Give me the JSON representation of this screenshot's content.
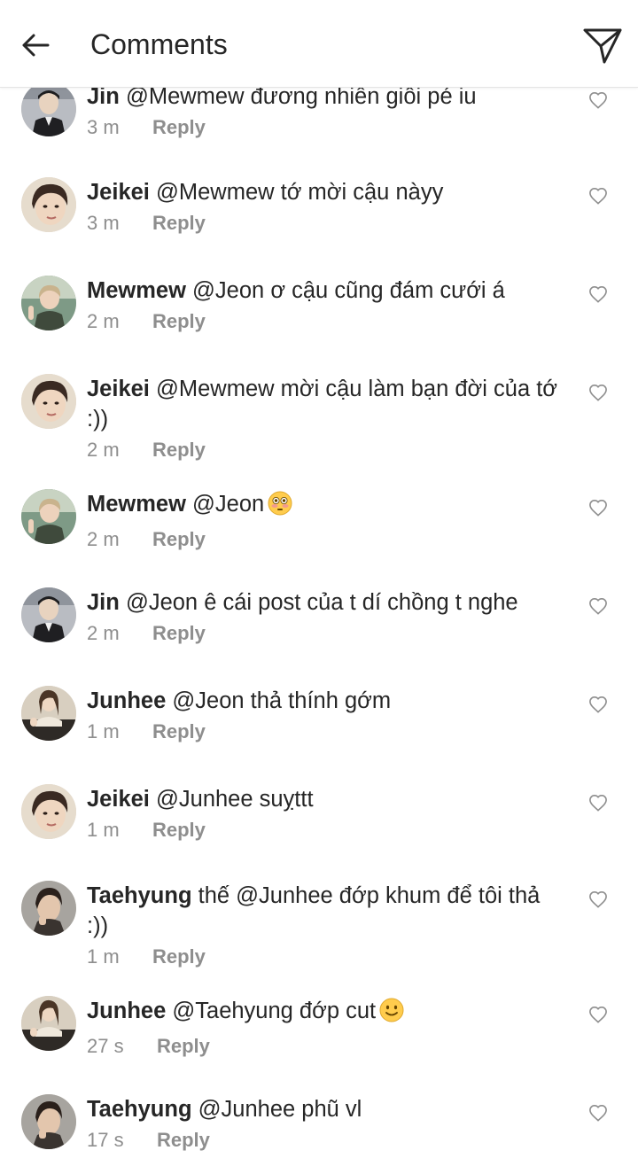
{
  "header": {
    "title": "Comments",
    "back_icon": "arrow-left-icon",
    "send_icon": "paper-plane-icon"
  },
  "reply_label": "Reply",
  "comments": [
    {
      "user": "Jin",
      "text": "@Mewmew đương nhiên giồi pé iu",
      "time": "3 m",
      "avatar": "jin"
    },
    {
      "user": "Jeikei",
      "text": "@Mewmew tớ mời cậu nàyy",
      "time": "3 m",
      "avatar": "jeikei"
    },
    {
      "user": "Mewmew",
      "text": "@Jeon ơ cậu cũng đám cưới á",
      "time": "2 m",
      "avatar": "mewmew"
    },
    {
      "user": "Jeikei",
      "text": "@Mewmew mời cậu làm bạn đời của tớ :))",
      "time": "2 m",
      "avatar": "jeikei"
    },
    {
      "user": "Mewmew",
      "text": "@Jeon",
      "time": "2 m",
      "avatar": "mewmew",
      "emoji": "flushed-face-emoji"
    },
    {
      "user": "Jin",
      "text": "@Jeon ê cái post của t dí chồng t nghe",
      "time": "2 m",
      "avatar": "jin"
    },
    {
      "user": "Junhee",
      "text": "@Jeon thả thính gớm",
      "time": "1 m",
      "avatar": "junhee"
    },
    {
      "user": "Jeikei",
      "text": "@Junhee suỵttt",
      "time": "1 m",
      "avatar": "jeikei"
    },
    {
      "user": "Taehyung",
      "text": "thế @Junhee đớp khum để tôi thả :))",
      "time": "1 m",
      "avatar": "taehyung"
    },
    {
      "user": "Junhee",
      "text": "@Taehyung đớp cut",
      "time": "27 s",
      "avatar": "junhee",
      "emoji": "slightly-smiling-face-emoji"
    },
    {
      "user": "Taehyung",
      "text": "@Junhee phũ vl",
      "time": "17 s",
      "avatar": "taehyung"
    }
  ],
  "colors": {
    "text": "#262626",
    "secondary": "#8e8e8e",
    "divider": "#e4e4e4",
    "emoji_yellow": "#ffcc4d"
  }
}
